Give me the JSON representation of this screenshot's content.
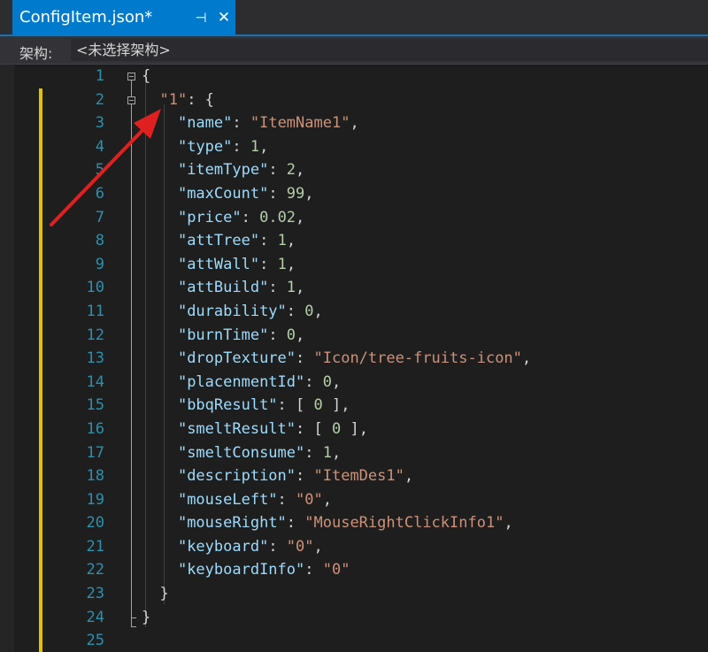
{
  "tab": {
    "title": "ConfigItem.json*",
    "pin_glyph": "⊣",
    "close_glyph": "✕"
  },
  "nav": {
    "label": "架构:",
    "selection": "<未选择架构>"
  },
  "colors": {
    "accent": "#007acc",
    "background": "#1e1e1e",
    "line_number": "#2b91af",
    "json_key": "#9cdcfe",
    "json_string": "#ce9178",
    "json_number": "#b5cea8",
    "change_marker": "#e5c100",
    "annotation_arrow": "#e02020"
  },
  "editor": {
    "line_numbers": [
      "1",
      "2",
      "3",
      "4",
      "5",
      "6",
      "7",
      "8",
      "9",
      "10",
      "11",
      "12",
      "13",
      "14",
      "15",
      "16",
      "17",
      "18",
      "19",
      "20",
      "21",
      "22",
      "23",
      "24",
      "25"
    ],
    "lines": [
      [
        {
          "t": "p",
          "v": "{"
        }
      ],
      [
        {
          "t": "p",
          "v": "  "
        },
        {
          "t": "s",
          "v": "\"1\""
        },
        {
          "t": "p",
          "v": ": {"
        }
      ],
      [
        {
          "t": "p",
          "v": "    "
        },
        {
          "t": "k",
          "v": "\"name\""
        },
        {
          "t": "p",
          "v": ": "
        },
        {
          "t": "s",
          "v": "\"ItemName1\""
        },
        {
          "t": "p",
          "v": ","
        }
      ],
      [
        {
          "t": "p",
          "v": "    "
        },
        {
          "t": "k",
          "v": "\"type\""
        },
        {
          "t": "p",
          "v": ": "
        },
        {
          "t": "n",
          "v": "1"
        },
        {
          "t": "p",
          "v": ","
        }
      ],
      [
        {
          "t": "p",
          "v": "    "
        },
        {
          "t": "k",
          "v": "\"itemType\""
        },
        {
          "t": "p",
          "v": ": "
        },
        {
          "t": "n",
          "v": "2"
        },
        {
          "t": "p",
          "v": ","
        }
      ],
      [
        {
          "t": "p",
          "v": "    "
        },
        {
          "t": "k",
          "v": "\"maxCount\""
        },
        {
          "t": "p",
          "v": ": "
        },
        {
          "t": "n",
          "v": "99"
        },
        {
          "t": "p",
          "v": ","
        }
      ],
      [
        {
          "t": "p",
          "v": "    "
        },
        {
          "t": "k",
          "v": "\"price\""
        },
        {
          "t": "p",
          "v": ": "
        },
        {
          "t": "n",
          "v": "0.02"
        },
        {
          "t": "p",
          "v": ","
        }
      ],
      [
        {
          "t": "p",
          "v": "    "
        },
        {
          "t": "k",
          "v": "\"attTree\""
        },
        {
          "t": "p",
          "v": ": "
        },
        {
          "t": "n",
          "v": "1"
        },
        {
          "t": "p",
          "v": ","
        }
      ],
      [
        {
          "t": "p",
          "v": "    "
        },
        {
          "t": "k",
          "v": "\"attWall\""
        },
        {
          "t": "p",
          "v": ": "
        },
        {
          "t": "n",
          "v": "1"
        },
        {
          "t": "p",
          "v": ","
        }
      ],
      [
        {
          "t": "p",
          "v": "    "
        },
        {
          "t": "k",
          "v": "\"attBuild\""
        },
        {
          "t": "p",
          "v": ": "
        },
        {
          "t": "n",
          "v": "1"
        },
        {
          "t": "p",
          "v": ","
        }
      ],
      [
        {
          "t": "p",
          "v": "    "
        },
        {
          "t": "k",
          "v": "\"durability\""
        },
        {
          "t": "p",
          "v": ": "
        },
        {
          "t": "n",
          "v": "0"
        },
        {
          "t": "p",
          "v": ","
        }
      ],
      [
        {
          "t": "p",
          "v": "    "
        },
        {
          "t": "k",
          "v": "\"burnTime\""
        },
        {
          "t": "p",
          "v": ": "
        },
        {
          "t": "n",
          "v": "0"
        },
        {
          "t": "p",
          "v": ","
        }
      ],
      [
        {
          "t": "p",
          "v": "    "
        },
        {
          "t": "k",
          "v": "\"dropTexture\""
        },
        {
          "t": "p",
          "v": ": "
        },
        {
          "t": "s",
          "v": "\"Icon/tree-fruits-icon\""
        },
        {
          "t": "p",
          "v": ","
        }
      ],
      [
        {
          "t": "p",
          "v": "    "
        },
        {
          "t": "k",
          "v": "\"placenmentId\""
        },
        {
          "t": "p",
          "v": ": "
        },
        {
          "t": "n",
          "v": "0"
        },
        {
          "t": "p",
          "v": ","
        }
      ],
      [
        {
          "t": "p",
          "v": "    "
        },
        {
          "t": "k",
          "v": "\"bbqResult\""
        },
        {
          "t": "p",
          "v": ": [ "
        },
        {
          "t": "n",
          "v": "0"
        },
        {
          "t": "p",
          "v": " ],"
        }
      ],
      [
        {
          "t": "p",
          "v": "    "
        },
        {
          "t": "k",
          "v": "\"smeltResult\""
        },
        {
          "t": "p",
          "v": ": [ "
        },
        {
          "t": "n",
          "v": "0"
        },
        {
          "t": "p",
          "v": " ],"
        }
      ],
      [
        {
          "t": "p",
          "v": "    "
        },
        {
          "t": "k",
          "v": "\"smeltConsume\""
        },
        {
          "t": "p",
          "v": ": "
        },
        {
          "t": "n",
          "v": "1"
        },
        {
          "t": "p",
          "v": ","
        }
      ],
      [
        {
          "t": "p",
          "v": "    "
        },
        {
          "t": "k",
          "v": "\"description\""
        },
        {
          "t": "p",
          "v": ": "
        },
        {
          "t": "s",
          "v": "\"ItemDes1\""
        },
        {
          "t": "p",
          "v": ","
        }
      ],
      [
        {
          "t": "p",
          "v": "    "
        },
        {
          "t": "k",
          "v": "\"mouseLeft\""
        },
        {
          "t": "p",
          "v": ": "
        },
        {
          "t": "s",
          "v": "\"0\""
        },
        {
          "t": "p",
          "v": ","
        }
      ],
      [
        {
          "t": "p",
          "v": "    "
        },
        {
          "t": "k",
          "v": "\"mouseRight\""
        },
        {
          "t": "p",
          "v": ": "
        },
        {
          "t": "s",
          "v": "\"MouseRightClickInfo1\""
        },
        {
          "t": "p",
          "v": ","
        }
      ],
      [
        {
          "t": "p",
          "v": "    "
        },
        {
          "t": "k",
          "v": "\"keyboard\""
        },
        {
          "t": "p",
          "v": ": "
        },
        {
          "t": "s",
          "v": "\"0\""
        },
        {
          "t": "p",
          "v": ","
        }
      ],
      [
        {
          "t": "p",
          "v": "    "
        },
        {
          "t": "k",
          "v": "\"keyboardInfo\""
        },
        {
          "t": "p",
          "v": ": "
        },
        {
          "t": "s",
          "v": "\"0\""
        }
      ],
      [
        {
          "t": "p",
          "v": "  }"
        }
      ],
      [
        {
          "t": "p",
          "v": "}"
        }
      ],
      []
    ]
  }
}
